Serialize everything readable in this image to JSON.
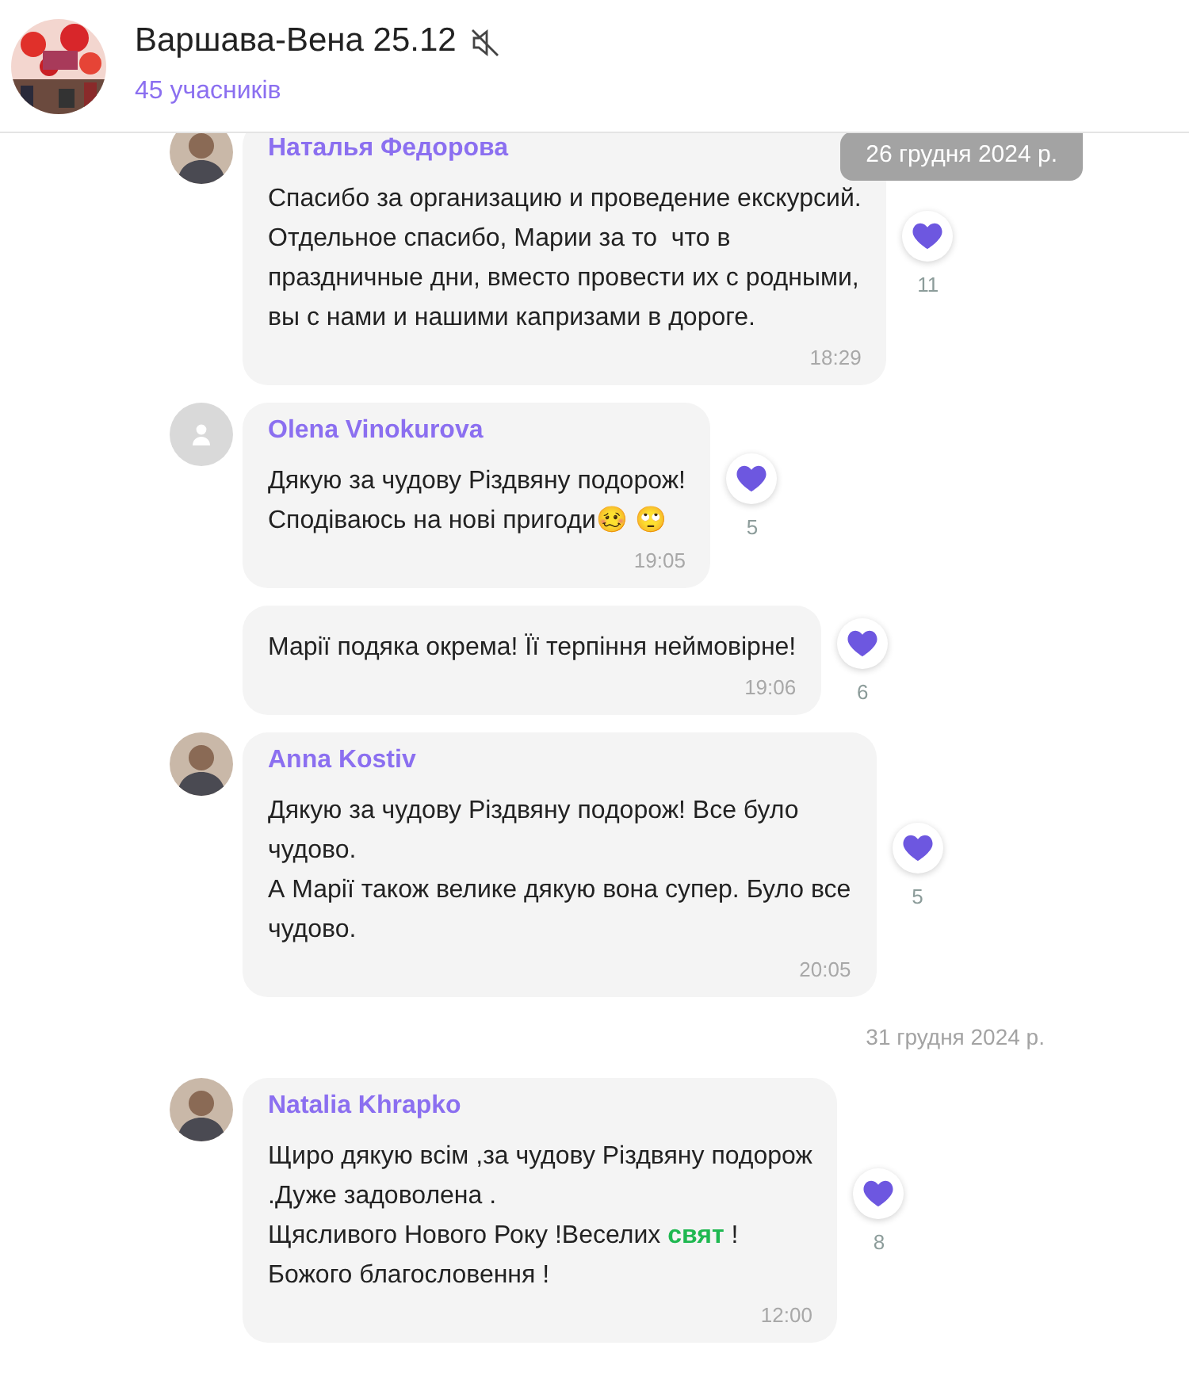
{
  "header": {
    "title": "Варшава-Вена 25.12",
    "muted": true,
    "members": "45 учасників"
  },
  "sticky_date": "26 грудня 2024 р.",
  "feed": [
    {
      "kind": "message",
      "author": "Наталья Федорова",
      "lines": [
        "Спасибо за организацию и проведение екскурсий.",
        "Отдельное спасибо, Марии за то  что в",
        "праздничные дни, вместо провести их с родными,",
        "вы с нами и нашими капризами в дороге."
      ],
      "time": "18:29",
      "reactions": "11"
    },
    {
      "kind": "message",
      "author": "Olena Vinokurova",
      "avatar": {
        "kind": "placeholder"
      },
      "lines": [
        "Дякую за чудову Різдвяну подорож!",
        "Сподіваюсь на нові пригоди🥴 🙄"
      ],
      "time": "19:05",
      "reactions": "5"
    },
    {
      "kind": "message",
      "lines": [
        "Марії подяка окрема! Її терпіння неймовірне!"
      ],
      "time": "19:06",
      "reactions": "6"
    },
    {
      "kind": "message",
      "author": "Anna Kostiv",
      "lines": [
        "Дякую за чудову Різдвяну подорож! Все було",
        "чудово.",
        "А Марії також велике дякую вона супер. Було все",
        "чудово."
      ],
      "time": "20:05",
      "reactions": "5"
    },
    {
      "kind": "date",
      "text": "31 грудня 2024 р."
    },
    {
      "kind": "message",
      "author": "Natalia Khrapko",
      "lines": [
        "Щиро дякую всім ,за чудову Різдвяну подорож",
        ".Дуже задоволена .",
        "Щясливого Нового Року !Веселих **свят** !",
        "Божого благословення !"
      ],
      "time": "12:00",
      "reactions": "8"
    }
  ]
}
